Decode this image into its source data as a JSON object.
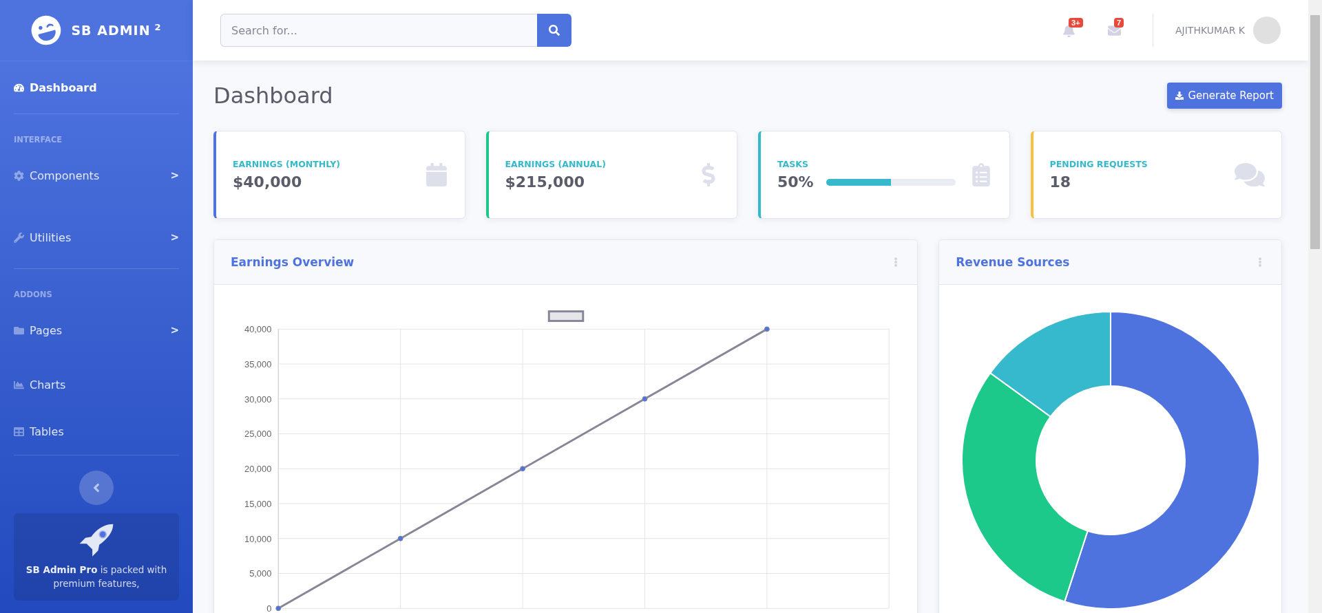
{
  "brand": {
    "name": "SB ADMIN",
    "sup": "2"
  },
  "sidebar": {
    "items": [
      {
        "kind": "link",
        "label": "Dashboard",
        "selected": true
      },
      {
        "kind": "divider"
      },
      {
        "kind": "heading",
        "label": "INTERFACE"
      },
      {
        "kind": "link",
        "label": "Components",
        "selected": false,
        "arrow": ">"
      },
      {
        "kind": "link",
        "label": "Utilities",
        "selected": false,
        "arrow": ">"
      },
      {
        "kind": "divider"
      },
      {
        "kind": "heading",
        "label": "ADDONS"
      },
      {
        "kind": "link",
        "label": "Pages",
        "selected": false,
        "arrow": ">"
      },
      {
        "kind": "link",
        "label": "Charts",
        "selected": false
      },
      {
        "kind": "link",
        "label": "Tables",
        "selected": false
      },
      {
        "kind": "divider"
      }
    ],
    "promo": {
      "text": "**SB Admin Pro** is packed with premium features,"
    }
  },
  "topbar": {
    "search": {
      "placeholder": "Search for..."
    },
    "alerts_badge": "3+",
    "messages_badge": "7",
    "user": "AJITHKUMAR K"
  },
  "page": {
    "title": "Dashboard",
    "button": "Generate Report"
  },
  "cards": [
    {
      "kind": "plain",
      "label": "EARNINGS (MONTHLY)",
      "value": "$40,000",
      "color": "#4e73df"
    },
    {
      "kind": "plain",
      "label": "EARNINGS (ANNUAL)",
      "value": "$215,000",
      "color": "#1cc88a"
    },
    {
      "kind": "progress",
      "label": "TASKS",
      "value": "50%",
      "level": 0.5,
      "color": "#36b9cc"
    },
    {
      "kind": "plain",
      "label": "PENDING REQUESTS",
      "value": "18",
      "color": "#f6c23e"
    }
  ],
  "earnings": {
    "title": "Earnings Overview",
    "chart_data": {
      "type": "line",
      "grid": true,
      "series": [
        {
          "color": "#858796",
          "marker": true,
          "values": [
            0,
            10000,
            20000,
            30000,
            40000,
            null
          ]
        }
      ],
      "ylim": [
        0,
        40000
      ],
      "yticks": [
        {
          "value": 0,
          "label": "0"
        },
        {
          "value": 5000,
          "label": "5,000"
        },
        {
          "value": 10000,
          "label": "10,000"
        },
        {
          "value": 15000,
          "label": "15,000"
        },
        {
          "value": 20000,
          "label": "20,000"
        },
        {
          "value": 25000,
          "label": "25,000"
        },
        {
          "value": 30000,
          "label": "30,000"
        },
        {
          "value": 35000,
          "label": "35,000"
        },
        {
          "value": 40000,
          "label": "40,000"
        }
      ]
    }
  },
  "revenue": {
    "title": "Revenue Sources"
  }
}
